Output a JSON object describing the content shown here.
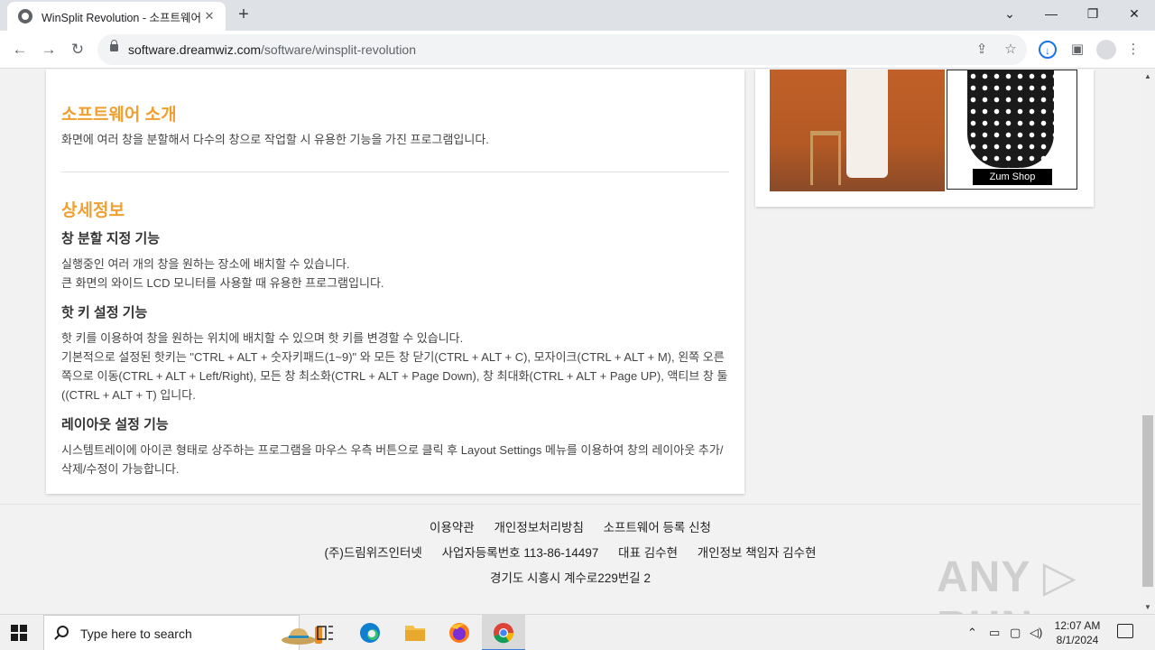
{
  "browser": {
    "tab_title": "WinSplit Revolution - 소프트웨어",
    "tab_close": "✕",
    "new_tab": "+",
    "url_domain": "software.dreamwiz.com",
    "url_path": "/software/winsplit-revolution",
    "window_controls": {
      "dropdown": "⌄",
      "minimize": "—",
      "maximize": "❐",
      "close": "✕"
    },
    "nav": {
      "back": "←",
      "forward": "→",
      "reload": "↻"
    }
  },
  "content": {
    "intro_title": "소프트웨어 소개",
    "intro_text": "화면에 여러 창을 분할해서 다수의 창으로 작업할 시 유용한 기능을 가진 프로그램입니다.",
    "detail_title": "상세정보",
    "sections": [
      {
        "title": "창 분할 지정 기능",
        "lines": [
          "실행중인 여러 개의 창을 원하는 장소에 배치할 수 있습니다.",
          "큰 화면의 와이드 LCD 모니터를 사용할 때 유용한 프로그램입니다."
        ]
      },
      {
        "title": "핫 키 설정 기능",
        "lines": [
          "핫 키를 이용하여 창을 원하는 위치에 배치할 수 있으며 핫 키를 변경할 수 있습니다.",
          "기본적으로 설정된 핫키는 \"CTRL + ALT + 숫자키패드(1~9)\" 와 모든 창 닫기(CTRL + ALT + C), 모자이크(CTRL + ALT + M), 왼쪽 오른쪽으로 이동(CTRL + ALT + Left/Right), 모든 창 최소화(CTRL + ALT + Page Down), 창 최대화(CTRL + ALT + Page UP), 액티브 창 툴((CTRL + ALT + T) 입니다."
        ]
      },
      {
        "title": "레이아웃 설정 기능",
        "lines": [
          "시스템트레이에 아이콘 형태로 상주하는 프로그램을 마우스 우측 버튼으로 클릭 후 Layout Settings 메뉴를 이용하여 창의 레이아웃 추가/삭제/수정이 가능합니다."
        ]
      }
    ]
  },
  "ad": {
    "label": "Zum Shop"
  },
  "footer": {
    "links": [
      "이용약관",
      "개인정보처리방침",
      "소프트웨어 등록 신청"
    ],
    "company": [
      "(주)드림위즈인터넷",
      "사업자등록번호 113-86-14497",
      "대표 김수현",
      "개인정보 책임자 김수현"
    ],
    "address": "경기도 시흥시 계수로229번길 2"
  },
  "watermark": "ANY ▷ RUN",
  "taskbar": {
    "search_placeholder": "Type here to search",
    "time": "12:07 AM",
    "date": "8/1/2024"
  }
}
